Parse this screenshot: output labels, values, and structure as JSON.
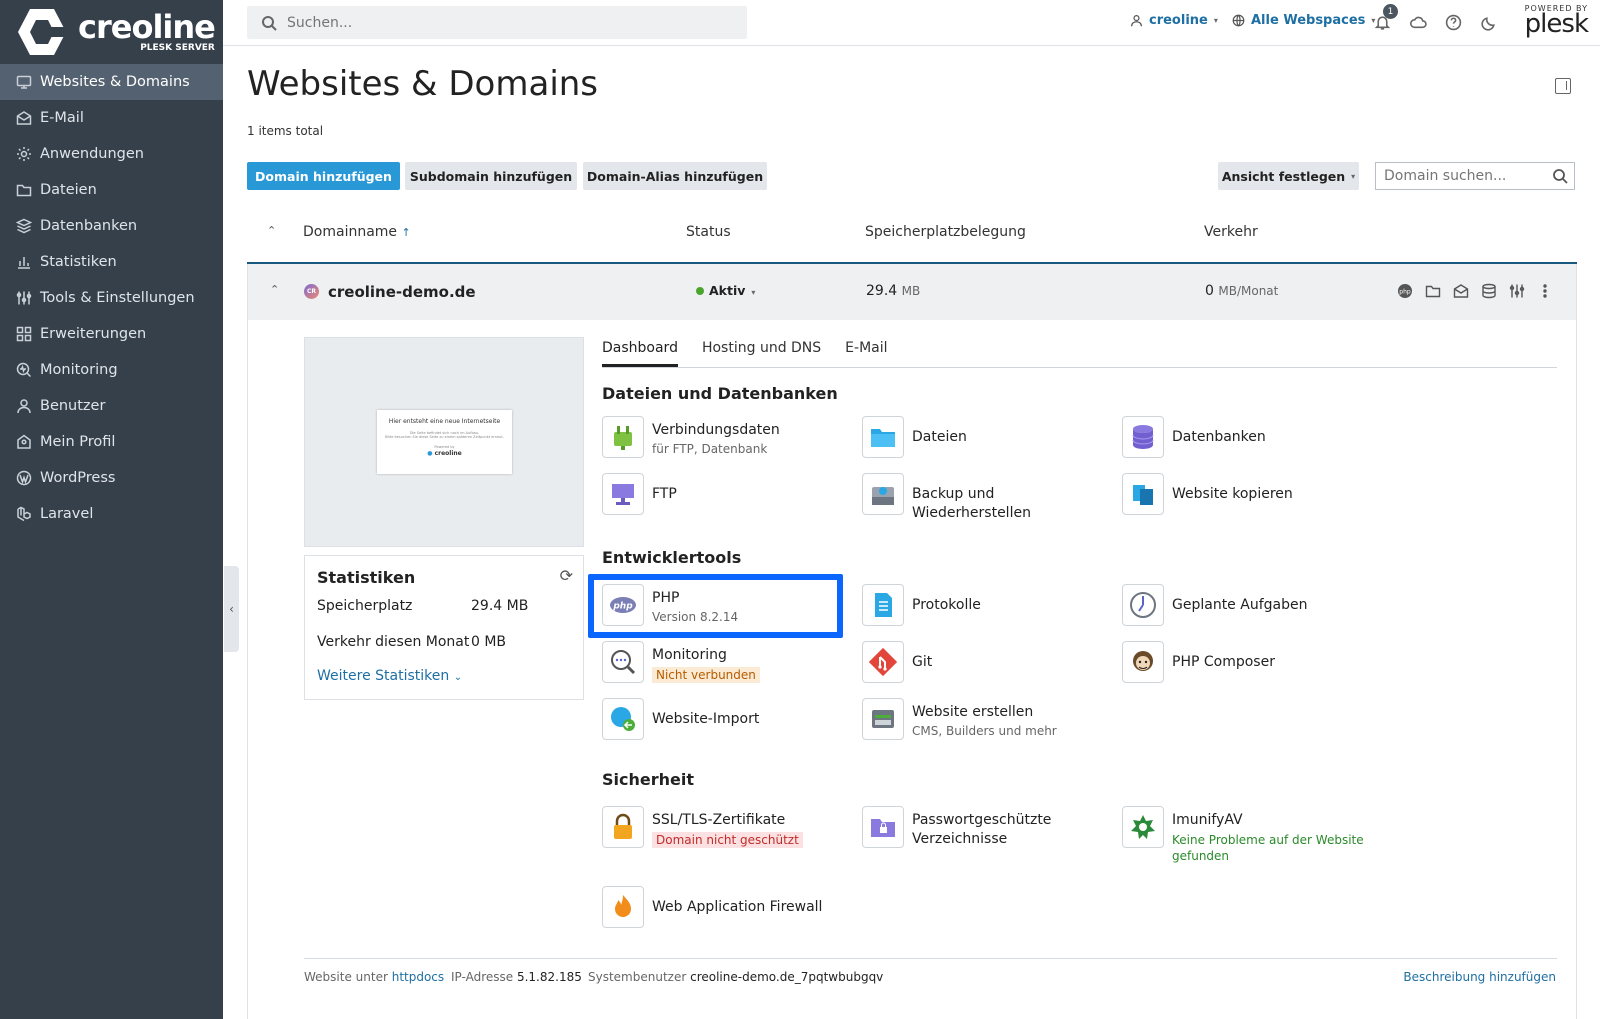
{
  "brand": {
    "name": "creoline",
    "sub": "PLESK SERVER",
    "powered": "POWERED BY",
    "plesk": "plesk"
  },
  "sidebar": {
    "items": [
      {
        "label": "Websites & Domains",
        "icon": "monitor-icon"
      },
      {
        "label": "E-Mail",
        "icon": "mail-icon"
      },
      {
        "label": "Anwendungen",
        "icon": "gear-icon"
      },
      {
        "label": "Dateien",
        "icon": "folder-icon"
      },
      {
        "label": "Datenbanken",
        "icon": "database-icon"
      },
      {
        "label": "Statistiken",
        "icon": "bar-chart-icon"
      },
      {
        "label": "Tools & Einstellungen",
        "icon": "sliders-icon"
      },
      {
        "label": "Erweiterungen",
        "icon": "extensions-icon"
      },
      {
        "label": "Monitoring",
        "icon": "monitoring-icon"
      },
      {
        "label": "Benutzer",
        "icon": "user-icon"
      },
      {
        "label": "Mein Profil",
        "icon": "profile-icon"
      },
      {
        "label": "WordPress",
        "icon": "wordpress-icon"
      },
      {
        "label": "Laravel",
        "icon": "laravel-icon"
      }
    ]
  },
  "header": {
    "search_placeholder": "Suchen...",
    "user": "creoline",
    "webspaces": "Alle Webspaces",
    "notifications": "1"
  },
  "main": {
    "title": "Websites & Domains",
    "items_total": "1 items total",
    "buttons": {
      "add_domain": "Domain hinzufügen",
      "add_subdomain": "Subdomain hinzufügen",
      "add_alias": "Domain-Alias hinzufügen",
      "view": "Ansicht festlegen"
    },
    "domain_search_placeholder": "Domain suchen...",
    "columns": {
      "name": "Domainname",
      "status": "Status",
      "storage": "Speicherplatzbelegung",
      "traffic": "Verkehr"
    },
    "row": {
      "avatar": "CR",
      "domain": "creoline-demo.de",
      "status": "Aktiv",
      "storage_value": "29.4",
      "storage_unit": "MB",
      "traffic_value": "0",
      "traffic_unit": "MB/Monat"
    }
  },
  "preview": {
    "headline": "Hier entsteht eine neue Internetseite",
    "line1": "Die Seite befindet sich noch im Aufbau.",
    "line2": "Bitte besuchen Sie diese Seite zu einem späteren Zeitpunkt erneut.",
    "powered": "Powered by",
    "logo": "creoline"
  },
  "stats": {
    "title": "Statistiken",
    "storage_label": "Speicherplatz",
    "storage_value": "29.4 MB",
    "traffic_label": "Verkehr diesen Monat",
    "traffic_value": "0 MB",
    "more": "Weitere Statistiken"
  },
  "tabs": [
    "Dashboard",
    "Hosting und DNS",
    "E-Mail"
  ],
  "sections": {
    "files": "Dateien und Datenbanken",
    "dev": "Entwicklertools",
    "security": "Sicherheit"
  },
  "tools": {
    "connection": {
      "title": "Verbindungsdaten",
      "sub": "für FTP, Datenbank"
    },
    "files": {
      "title": "Dateien"
    },
    "databases": {
      "title": "Datenbanken"
    },
    "ftp": {
      "title": "FTP"
    },
    "backup": {
      "title": "Backup und Wiederherstellen"
    },
    "copy": {
      "title": "Website kopieren"
    },
    "php": {
      "title": "PHP",
      "sub": "Version 8.2.14"
    },
    "logs": {
      "title": "Protokolle"
    },
    "tasks": {
      "title": "Geplante Aufgaben"
    },
    "monitoring": {
      "title": "Monitoring",
      "tag": "Nicht verbunden"
    },
    "git": {
      "title": "Git"
    },
    "composer": {
      "title": "PHP Composer"
    },
    "import": {
      "title": "Website-Import"
    },
    "builder": {
      "title": "Website erstellen",
      "sub": "CMS, Builders und mehr"
    },
    "ssl": {
      "title": "SSL/TLS-Zertifikate",
      "tag": "Domain nicht geschützt"
    },
    "protected": {
      "title": "Passwortgeschützte Verzeichnisse"
    },
    "imunify": {
      "title": "ImunifyAV",
      "tag": "Keine Probleme auf der Website gefunden"
    },
    "waf": {
      "title": "Web Application Firewall"
    }
  },
  "footer": {
    "website_label": "Website unter",
    "website_value": "httpdocs",
    "ip_label": "IP-Adresse",
    "ip_value": "5.1.82.185",
    "sysuser_label": "Systembenutzer",
    "sysuser_value": "creoline-demo.de_7pqtwbubgqv",
    "add_description": "Beschreibung hinzufügen"
  }
}
